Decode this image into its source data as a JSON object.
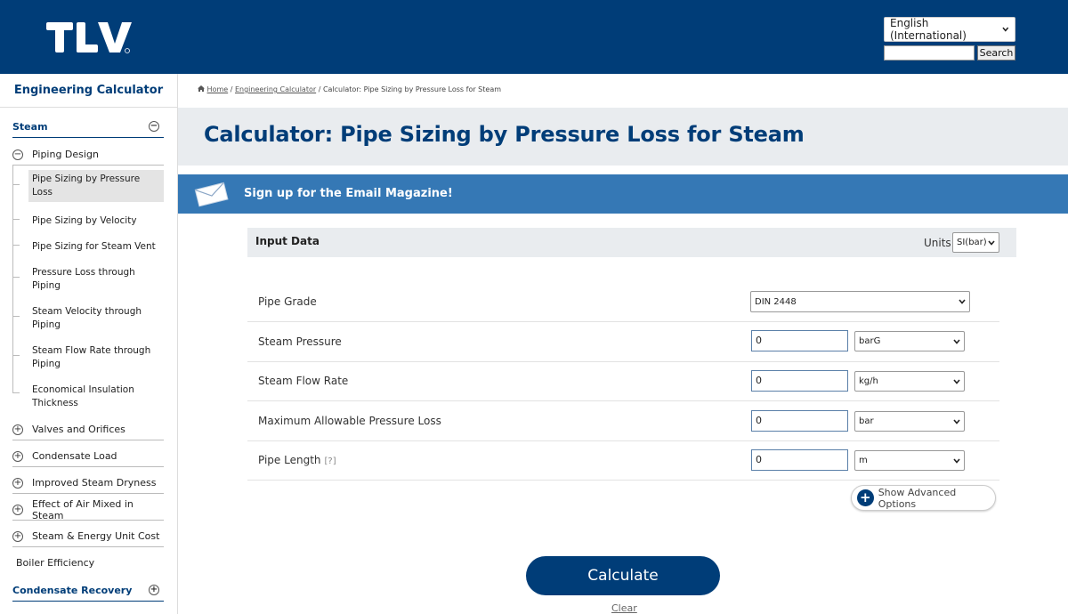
{
  "header": {
    "logo_text": "TLV",
    "brand_color": "#003d78",
    "language_select": {
      "selected": "English (International)"
    },
    "search_button": "Search"
  },
  "sidebar": {
    "title": "Engineering Calculator",
    "category_steam": "Steam",
    "piping_design": "Piping Design",
    "piping_items": [
      {
        "label": "Pipe Sizing by Pressure Loss",
        "active": true
      },
      {
        "label": "Pipe Sizing by Velocity"
      },
      {
        "label": "Pipe Sizing for Steam Vent"
      },
      {
        "label": "Pressure Loss through Piping"
      },
      {
        "label": "Steam Velocity through Piping"
      },
      {
        "label": "Steam Flow Rate through Piping"
      },
      {
        "label": "Economical Insulation Thickness"
      }
    ],
    "groups": [
      "Valves and Orifices",
      "Condensate Load",
      "Improved Steam Dryness",
      "Effect of Air Mixed in Steam",
      "Steam & Energy Unit Cost"
    ],
    "boiler_efficiency": "Boiler Efficiency",
    "category_condensate": "Condensate Recovery"
  },
  "breadcrumb": {
    "home": "Home",
    "sep": "/",
    "engineering_calculator": "Engineering Calculator",
    "current": "Calculator: Pipe Sizing by Pressure Loss for Steam"
  },
  "page_title": "Calculator: Pipe Sizing by Pressure Loss for Steam",
  "magazine_banner": "Sign up for the Email Magazine!",
  "input_data": {
    "heading": "Input Data",
    "units_label": "Units",
    "units_value": "SI(bar)",
    "rows": {
      "pipe_grade": {
        "label": "Pipe Grade",
        "value": "DIN 2448"
      },
      "steam_pressure": {
        "label": "Steam Pressure",
        "value": "0",
        "unit": "barG"
      },
      "steam_flow_rate": {
        "label": "Steam Flow Rate",
        "value": "0",
        "unit": "kg/h"
      },
      "max_pressure_loss": {
        "label": "Maximum Allowable Pressure Loss",
        "value": "0",
        "unit": "bar"
      },
      "pipe_length": {
        "label": "Pipe Length",
        "help": "[?]",
        "value": "0",
        "unit": "m"
      }
    },
    "advanced_options": "Show Advanced Options"
  },
  "actions": {
    "calculate": "Calculate",
    "clear": "Clear"
  }
}
